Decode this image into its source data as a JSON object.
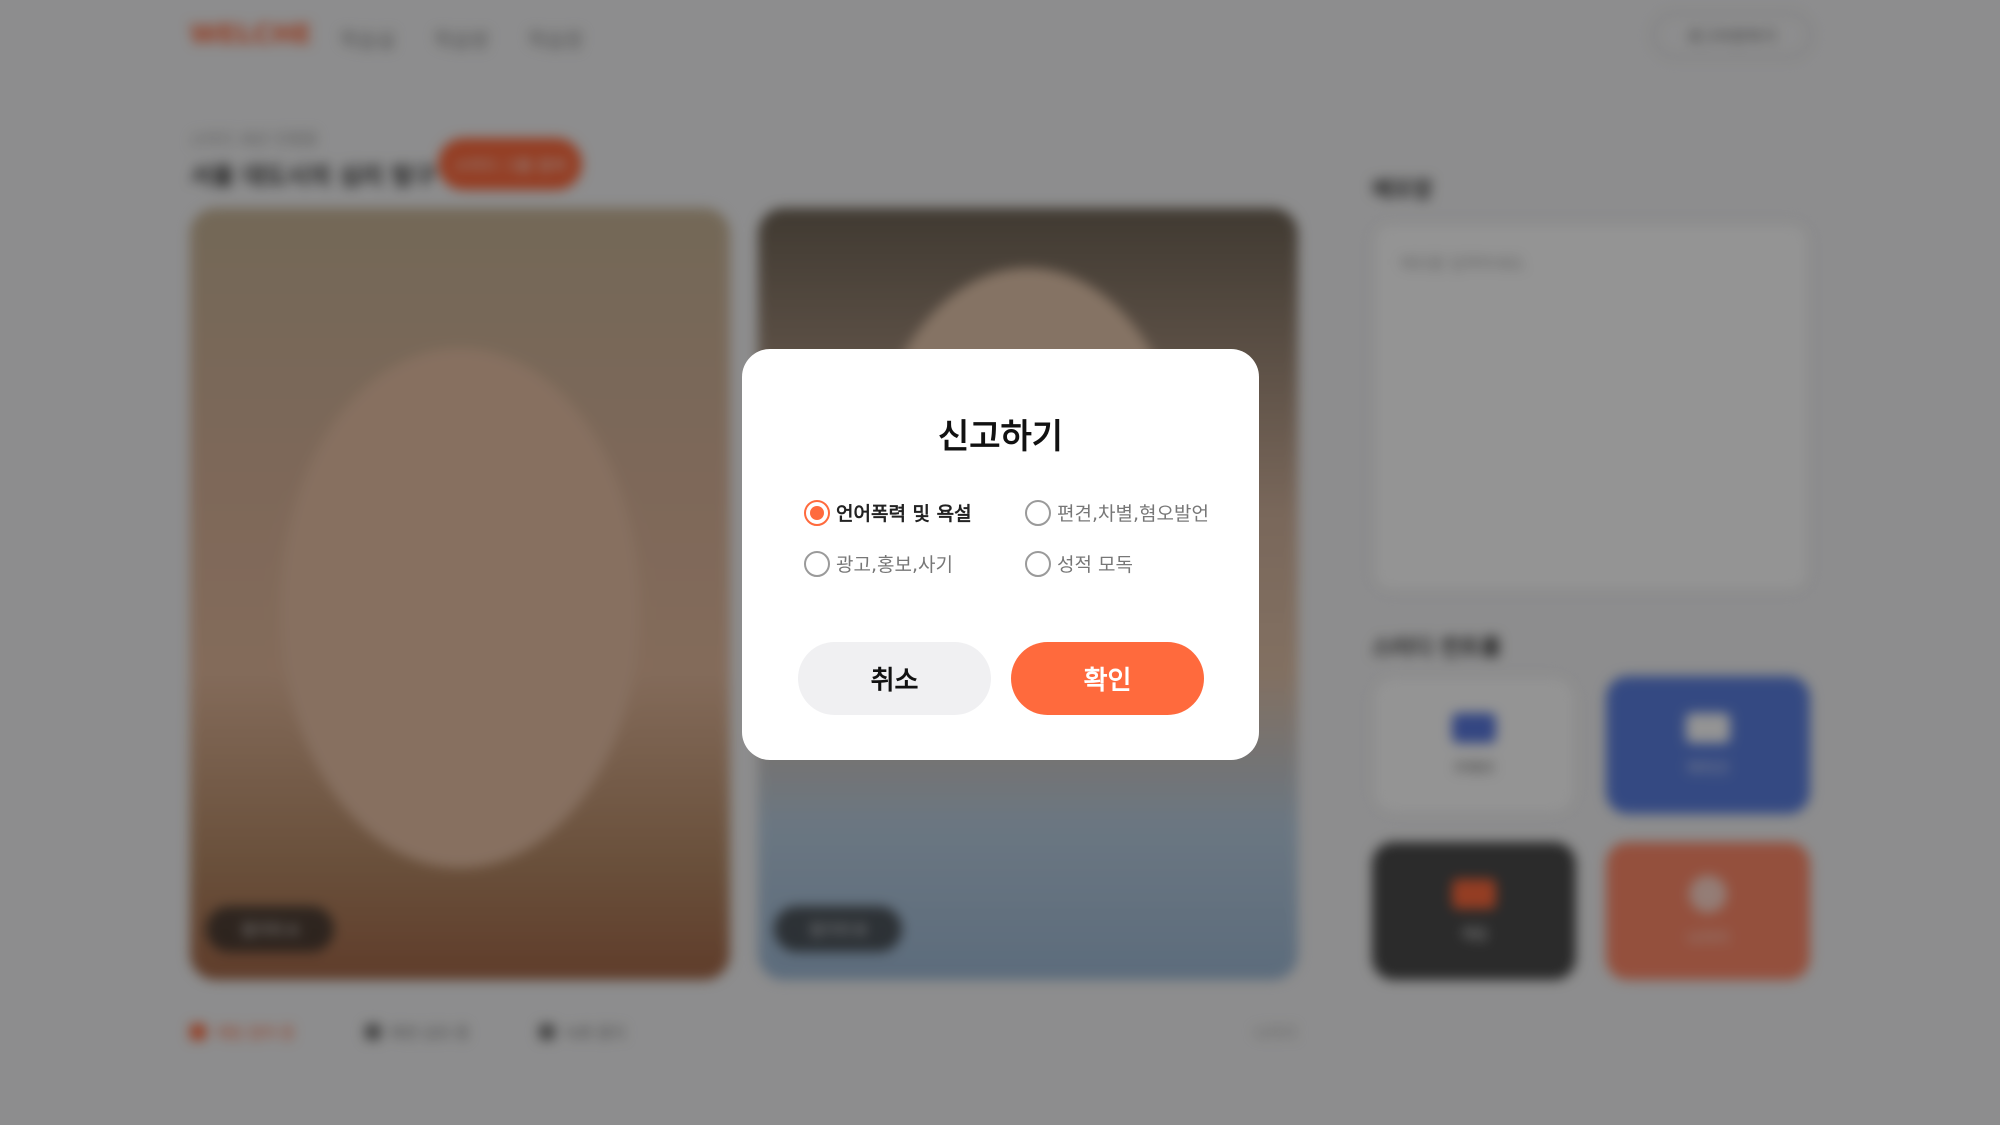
{
  "background": {
    "logo": "WELCHE",
    "nav": [
      "학습실",
      "학습방",
      "학습장"
    ],
    "login_label": "로그아웃하기",
    "room_subtitle": "스터디 세션 진행중",
    "room_title": "서울 대도시의 심리 탐구 방",
    "room_badge": "스터디 그룹 참여",
    "video_1_name": "참가자 A",
    "video_2_name": "참가자 B",
    "bottom_bar": {
      "items": [
        "채팅 참여 중",
        "화면 공유 중",
        "녹화 중지"
      ],
      "right": "나가기"
    },
    "memo": {
      "title": "메모장",
      "placeholder": "메모를 입력하세요."
    },
    "controls": {
      "title": "스터디 컨트롤",
      "items": [
        "카메라",
        "마이크",
        "게임",
        "나가기"
      ]
    }
  },
  "modal": {
    "title": "신고하기",
    "options": [
      {
        "label": "언어폭력 및 욕설",
        "selected": true
      },
      {
        "label": "편견,차별,혐오발언",
        "selected": false
      },
      {
        "label": "광고,홍보,사기",
        "selected": false
      },
      {
        "label": "성적 모독",
        "selected": false
      }
    ],
    "cancel_label": "취소",
    "confirm_label": "확인"
  },
  "colors": {
    "accent": "#ff6a3d",
    "overlay": "rgba(0,0,0,0.42)",
    "cancel_bg": "#f0f0f2"
  }
}
